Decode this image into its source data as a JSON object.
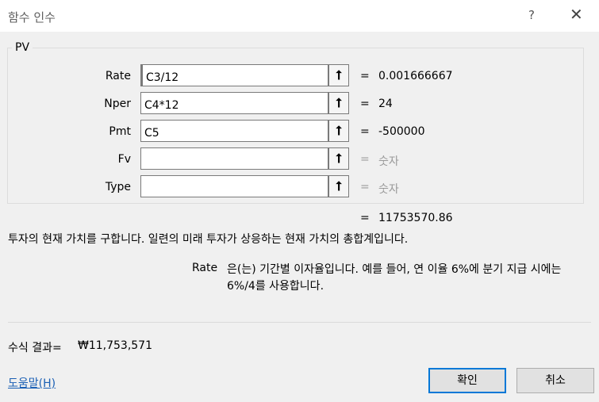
{
  "window": {
    "title": "함수 인수",
    "help_glyph": "?",
    "close_glyph": "✕"
  },
  "function": {
    "name": "PV",
    "arguments": [
      {
        "label": "Rate",
        "value": "C3/12",
        "result": "0.001666667",
        "placeholder": false
      },
      {
        "label": "Nper",
        "value": "C4*12",
        "result": "24",
        "placeholder": false
      },
      {
        "label": "Pmt",
        "value": "C5",
        "result": "-500000",
        "placeholder": false
      },
      {
        "label": "Fv",
        "value": "",
        "result": "숫자",
        "placeholder": true
      },
      {
        "label": "Type",
        "value": "",
        "result": "숫자",
        "placeholder": true
      }
    ],
    "ref_glyph": "⭡",
    "equals": "=",
    "total_result": "11753570.86"
  },
  "description": "투자의 현재 가치를 구합니다. 일련의 미래 투자가 상응하는 현재 가치의 총합계입니다.",
  "arg_help": {
    "name": "Rate",
    "text": "은(는) 기간별 이자율입니다. 예를 들어, 연 이율 6%에 분기 지급 시에는 6%/4를 사용합니다."
  },
  "formula_result": {
    "label": "수식 결과=",
    "value": "₩11,753,571"
  },
  "help_link": "도움말(H)",
  "buttons": {
    "ok": "확인",
    "cancel": "취소"
  },
  "colors": {
    "link": "#1a5fb4",
    "default_button_border": "#0078d7",
    "placeholder_text": "#9a9a9a"
  }
}
